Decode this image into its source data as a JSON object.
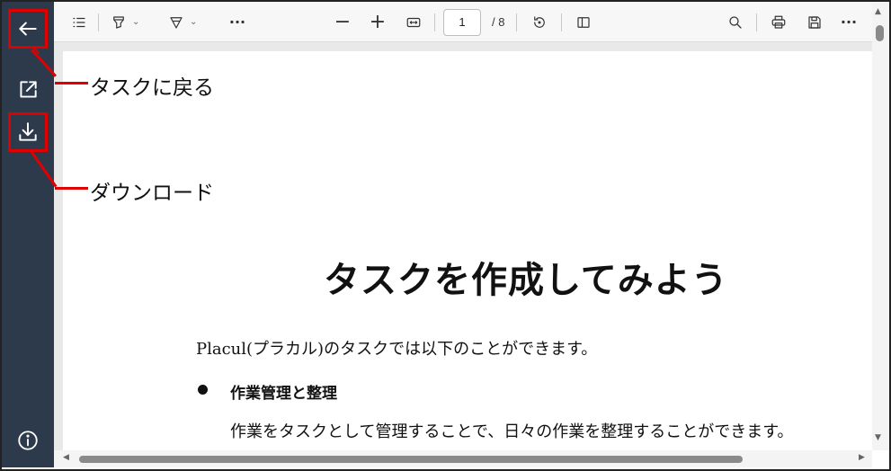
{
  "toolbar": {
    "current_page": "1",
    "total_pages": "/ 8"
  },
  "annotations": {
    "back_label": "タスクに戻る",
    "download_label": "ダウンロード"
  },
  "document": {
    "title": "タスクを作成してみよう",
    "intro": "Placul(プラカル)のタスクでは以下のことができます。",
    "bullets": [
      {
        "heading": "作業管理と整理",
        "body": "作業をタスクとして管理することで、日々の作業を整理することができます。"
      }
    ]
  },
  "colors": {
    "sidebar": "#2d3a4c",
    "highlight": "#e00000"
  },
  "icons": [
    "back-arrow-icon",
    "open-external-icon",
    "download-icon",
    "info-icon",
    "outline-icon",
    "highlight-icon",
    "draw-icon",
    "more-icon",
    "zoom-out-icon",
    "zoom-in-icon",
    "fit-width-icon",
    "rotate-icon",
    "page-view-icon",
    "search-icon",
    "print-icon",
    "save-icon"
  ]
}
